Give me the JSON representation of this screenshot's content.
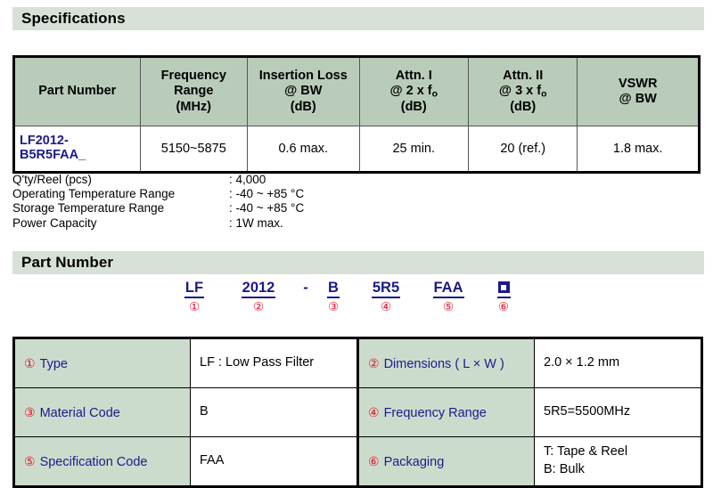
{
  "sections": {
    "specifications_title": "Specifications",
    "part_number_title": "Part Number"
  },
  "spec_table": {
    "headers": [
      {
        "line1": "Part Number",
        "line2": "",
        "line3": ""
      },
      {
        "line1": "Frequency",
        "line2": "Range",
        "line3": "(MHz)"
      },
      {
        "line1": "Insertion Loss",
        "line2": "@ BW",
        "line3": "(dB)"
      },
      {
        "line1": "Attn. I",
        "line2": "@ 2 x f",
        "line2_sub": "o",
        "line3": "(dB)"
      },
      {
        "line1": "Attn. II",
        "line2": "@ 3 x f",
        "line2_sub": "o",
        "line3": "(dB)"
      },
      {
        "line1": "VSWR",
        "line2": "@ BW",
        "line3": ""
      }
    ],
    "row": {
      "part_number_line1": "LF2012-",
      "part_number_line2": "B5R5FAA_",
      "frequency_range": "5150~5875",
      "insertion_loss": "0.6 max.",
      "attenuation_1": "25 min.",
      "attenuation_2": "20 (ref.)",
      "vswr": "1.8 max."
    }
  },
  "spec_list": [
    {
      "label": "Q'ty/Reel (pcs)",
      "value": ": 4,000"
    },
    {
      "label": "Operating Temperature Range",
      "value": ": -40 ~ +85 °C"
    },
    {
      "label": "Storage Temperature Range",
      "value": ": -40 ~ +85 °C"
    },
    {
      "label": "Power Capacity",
      "value": ": 1W max."
    }
  ],
  "part_number_breakdown": {
    "tokens": [
      {
        "text": "LF",
        "mark": "①"
      },
      {
        "text": "2012",
        "mark": "②"
      },
      {
        "text": "-",
        "mark": ""
      },
      {
        "text": "B",
        "mark": "③"
      },
      {
        "text": "5R5",
        "mark": "④"
      },
      {
        "text": "FAA",
        "mark": "⑤"
      },
      {
        "text": "",
        "mark": "⑥"
      }
    ]
  },
  "legend": {
    "rows": [
      {
        "left": {
          "mark": "①",
          "label": "Type",
          "value_line1": "LF : Low Pass Filter",
          "value_line2": ""
        },
        "right": {
          "mark": "②",
          "label": "Dimensions ( L × W )",
          "value_line1": "2.0 × 1.2 mm",
          "value_line2": ""
        }
      },
      {
        "left": {
          "mark": "③",
          "label": "Material Code",
          "value_line1": "B",
          "value_line2": ""
        },
        "right": {
          "mark": "④",
          "label": "Frequency Range",
          "value_line1": "5R5=5500MHz",
          "value_line2": ""
        }
      },
      {
        "left": {
          "mark": "⑤",
          "label": "Specification Code",
          "value_line1": "FAA",
          "value_line2": ""
        },
        "right": {
          "mark": "⑥",
          "label": "Packaging",
          "value_line1": "T: Tape & Reel",
          "value_line2": "B: Bulk"
        }
      }
    ]
  },
  "colors": {
    "band_green": "#d7e1d7",
    "header_green": "#b9ccb9",
    "legend_green": "#ccdccc",
    "navy": "#1a1a8c",
    "red": "#e8102a"
  }
}
